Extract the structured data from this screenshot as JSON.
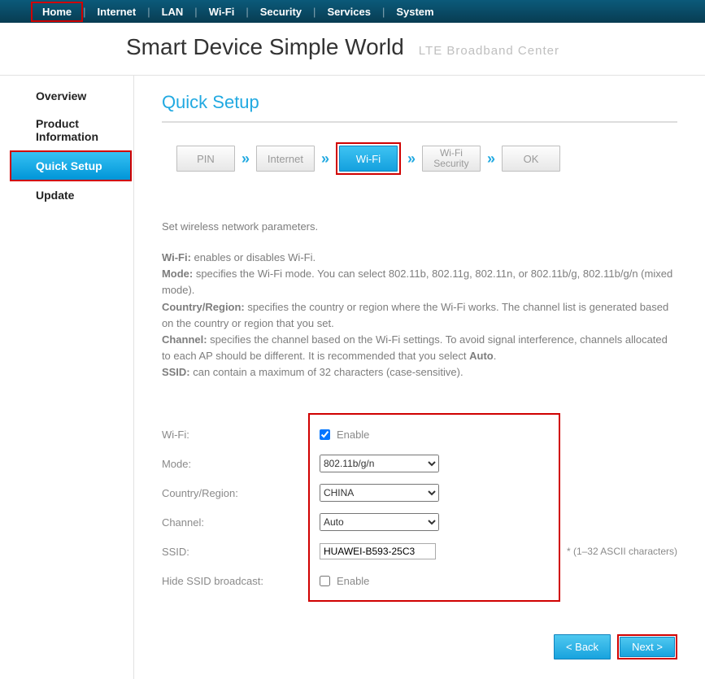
{
  "topnav": {
    "items": [
      {
        "label": "Home",
        "active": true
      },
      {
        "label": "Internet"
      },
      {
        "label": "LAN"
      },
      {
        "label": "Wi-Fi"
      },
      {
        "label": "Security"
      },
      {
        "label": "Services"
      },
      {
        "label": "System"
      }
    ]
  },
  "brand": {
    "main": "Smart Device   Simple World",
    "sub": "LTE  Broadband  Center"
  },
  "sidebar": {
    "items": [
      {
        "label": "Overview"
      },
      {
        "label": "Product Information"
      },
      {
        "label": "Quick Setup",
        "active": true
      },
      {
        "label": "Update"
      }
    ]
  },
  "page_title": "Quick Setup",
  "stepper": {
    "steps": [
      {
        "label": "PIN"
      },
      {
        "label": "Internet"
      },
      {
        "label": "Wi-Fi",
        "active": true
      },
      {
        "label": "Wi-Fi Security"
      },
      {
        "label": "OK"
      }
    ]
  },
  "desc": {
    "intro": "Set wireless network parameters.",
    "wifi_l": "Wi-Fi:",
    "wifi_t": " enables or disables Wi-Fi.",
    "mode_l": "Mode:",
    "mode_t": " specifies the Wi-Fi mode. You can select 802.11b, 802.11g, 802.11n, or 802.11b/g, 802.11b/g/n (mixed mode).",
    "cr_l": "Country/Region:",
    "cr_t": " specifies the country or region where the Wi-Fi works. The channel list is generated based on the country or region that you set.",
    "ch_l": "Channel:",
    "ch_t1": " specifies the channel based on the Wi-Fi settings. To avoid signal interference, channels allocated to each AP should be different. It is recommended that you select ",
    "ch_auto": "Auto",
    "ch_t2": ".",
    "ssid_l": "SSID:",
    "ssid_t": " can contain a maximum of 32 characters (case-sensitive)."
  },
  "form": {
    "wifi_label": "Wi-Fi:",
    "wifi_enable": "Enable",
    "wifi_checked": true,
    "mode_label": "Mode:",
    "mode_value": "802.11b/g/n",
    "cr_label": "Country/Region:",
    "cr_value": "CHINA",
    "ch_label": "Channel:",
    "ch_value": "Auto",
    "ssid_label": "SSID:",
    "ssid_value": "HUAWEI-B593-25C3",
    "ssid_hint": "*   (1–32 ASCII characters)",
    "hide_label": "Hide SSID broadcast:",
    "hide_enable": "Enable",
    "hide_checked": false
  },
  "actions": {
    "back": "< Back",
    "next": "Next >"
  }
}
